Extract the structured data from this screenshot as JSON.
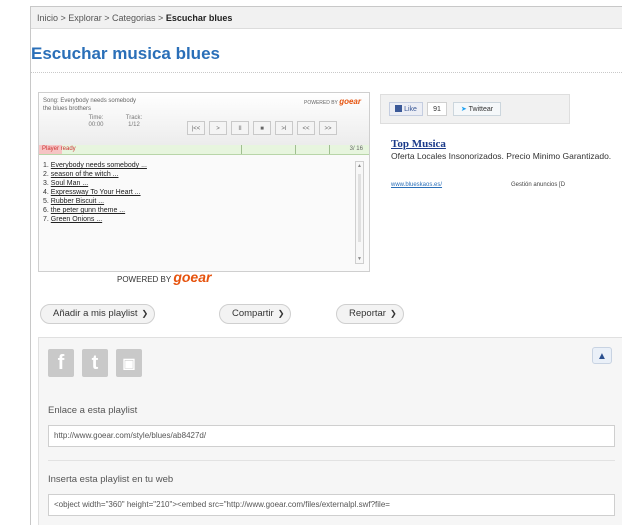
{
  "breadcrumb": {
    "path": "Inicio > Explorar > Categorias > ",
    "current": "Escuchar blues"
  },
  "page_title": "Escuchar musica blues",
  "player": {
    "song_line1": "Song: Everybody needs somebody",
    "song_line2": "the blues brothers",
    "powered_small_prefix": "POWERED BY",
    "powered_small_brand": "goear",
    "time_label": "Time:",
    "time_value": "00:00",
    "track_label": "Track:",
    "track_value": "1/12",
    "status": "Player ready",
    "count": "3/ 16",
    "progress_fraction": 0.07,
    "controls": [
      "|<<",
      ">",
      "II",
      "■",
      ">I",
      "<<",
      ">>"
    ],
    "tracks": [
      {
        "num": "1.",
        "title": "Everybody needs somebody ..."
      },
      {
        "num": "2.",
        "title": "season of the witch ..."
      },
      {
        "num": "3.",
        "title": "Soul Man ..."
      },
      {
        "num": "4.",
        "title": "Expressway To Your Heart ..."
      },
      {
        "num": "5.",
        "title": "Rubber Biscuit ..."
      },
      {
        "num": "6.",
        "title": "the peter gunn theme ..."
      },
      {
        "num": "7.",
        "title": "Green Onions ..."
      }
    ],
    "powered_main_prefix": "POWERED BY",
    "powered_main_brand": "goear"
  },
  "social": {
    "like_label": "Like",
    "like_count": "91",
    "tweet_label": "Twittear"
  },
  "ad": {
    "title": "Top Musica",
    "text": "Oferta Locales Insonorizados. Precio Minimo Garantizado.",
    "url": "www.blueskaos.es/",
    "mgmt": "Gestión anuncios [D"
  },
  "actions": {
    "add_playlist": "Añadir a mis playlist",
    "share": "Compartir",
    "report": "Reportar"
  },
  "share_panel": {
    "link_label": "Enlace a esta playlist",
    "link_value": "http://www.goear.com/style/blues/ab8427d/",
    "embed_label": "Inserta esta playlist en tu web",
    "embed_value": "<object width=\"360\" height=\"210\"><embed src=\"http://www.goear.com/files/externalpl.swf?file="
  },
  "colors": {
    "title_blue": "#2a6fb8",
    "brand_orange": "#e6530e",
    "status_red": "#cc3333"
  }
}
